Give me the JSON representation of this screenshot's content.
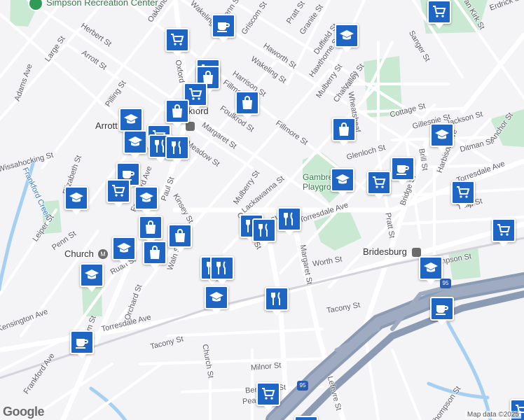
{
  "map": {
    "attribution": "Map data ©2025",
    "logo": "Google",
    "places": [
      {
        "name": "Simpson Recreation Center",
        "key": "simpson"
      },
      {
        "name": "Frankford",
        "key": "frankford"
      },
      {
        "name": "Bridesburg",
        "key": "bridesburg"
      },
      {
        "name": "Church",
        "key": "church"
      },
      {
        "name": "Arrott",
        "key": "arrott"
      },
      {
        "name": "Gambrel Playground",
        "key": "gambrel"
      }
    ],
    "streets": {
      "oakland": "Oakland",
      "wakeling1": "Wakeling St",
      "penn1": "Penn St",
      "griscom": "Griscom St",
      "pratt1": "Pratt St",
      "granite": "Granite St",
      "duffield": "Duffield St",
      "herbert": "Herbert St",
      "arrott": "Arrott St",
      "large": "Large St",
      "haworth": "Haworth St",
      "wakeling2": "Wakeling St",
      "hawthorne": "Hawthorne St",
      "adams": "Adams Ave",
      "pilling": "Pilling St",
      "oxford": "Oxford",
      "harrison": "Harrison St",
      "fillmore1": "Fillmore",
      "mulberry1": "Mulberry St",
      "chalres": "Chalres St",
      "valley": "Valley St",
      "foulkrod": "Foulkrod St",
      "margaret1": "Margaret St",
      "fillmore2": "Fillmore St",
      "cottage": "Cottage St",
      "gillespie": "Gillespie St",
      "jackson": "Jackson St",
      "anchor": "Anchor St",
      "glenloch": "Glenloch St",
      "ditman": "Ditman St",
      "brill": "Brill St",
      "harbison": "Harbison Ave",
      "wheatsheaf": "Wheatsheaf",
      "torresdale1": "Torresdale Ave",
      "tulip": "Tulip St",
      "wissahocking": "Wissahocking St",
      "elizabeth": "Elizabeth St",
      "frankfordave1": "Frankford Ave",
      "frankfordcreek": "Frankford Creek",
      "meadow": "Meadow St",
      "paul": "Paul St",
      "kinsey": "Kinsey St",
      "mulberry2": "Mulberry St",
      "lackawanna": "Lackawanna St",
      "ruan1": "Ruan St",
      "leiper": "Leiper St",
      "penn2": "Penn St",
      "orthodox": "Orthodox St",
      "waln": "Waln St",
      "torresdale2": "Torresdale Ave",
      "pratt2": "Pratt St",
      "bridge": "Bridge St",
      "margaret2": "Margaret St",
      "worth": "Worth St",
      "thompson1": "Thompson St",
      "ruan2": "Ruan St",
      "orchard": "Orchard St",
      "kensington": "Kensington Ave",
      "helm": "Helm St",
      "torresdale3": "Torresdale Ave",
      "tacony1": "Tacony St",
      "tacony2": "Tacony St",
      "church": "Church St",
      "frankfordave2": "Frankford Ave",
      "milnor": "Milnor St",
      "bermuda": "Bermuda St",
      "pearce": "Pearce St",
      "lefevre": "Lefevre St",
      "thompson2": "Thompson St",
      "vankirk": "Van Kirk St",
      "sanger": "Sanger St",
      "erdrick": "Erdrick St"
    },
    "pin_icons": {
      "shop": "shopping-cart-icon",
      "cafe": "coffee-cup-icon",
      "school": "graduation-cap-icon",
      "bag": "shopping-bag-icon",
      "food": "fork-knife-icon",
      "station": "train-station-icon"
    },
    "colors": {
      "pin": "#1f66c4",
      "park": "#c9e9d3",
      "highway": "#8c9bb4",
      "water": "#a6d0f2"
    }
  }
}
